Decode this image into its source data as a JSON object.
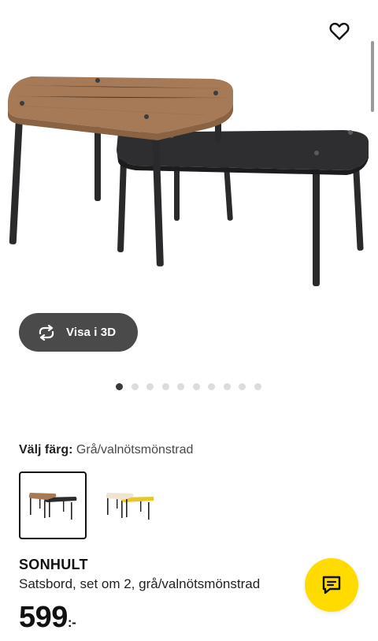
{
  "gallery": {
    "view_3d_label": "Visa i 3D",
    "total_images": 10,
    "active_index": 0
  },
  "color_picker": {
    "label": "Välj färg:",
    "selected_value": "Grå/valnötsmönstrad",
    "swatches": [
      {
        "name": "grey-walnut",
        "selected": true
      },
      {
        "name": "white-yellow",
        "selected": false
      }
    ]
  },
  "product": {
    "name": "SONHULT",
    "description": "Satsbord, set om 2, grå/valnötsmönstrad",
    "price": "599",
    "price_suffix": ":-"
  },
  "colors": {
    "chat_button": "#ffdb00",
    "view3d_button": "#4a4a4a",
    "walnut": "#a67a57",
    "anthracite": "#2c2c2e",
    "yellow": "#e8c72a"
  },
  "icons": {
    "favorite": "heart-outline-icon",
    "view3d": "rotate-arrows-icon",
    "chat": "chat-bubble-icon"
  }
}
